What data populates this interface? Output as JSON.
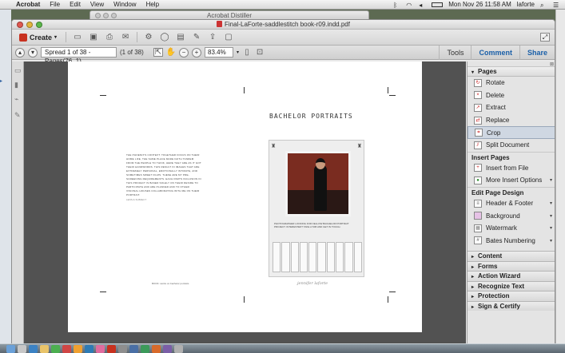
{
  "menubar": {
    "app_name": "Acrobat",
    "menus": [
      "File",
      "Edit",
      "View",
      "Window",
      "Help"
    ],
    "clock": "Mon Nov 26  11:58 AM",
    "user": "laforte"
  },
  "background_window": {
    "title": "Acrobat Distiller"
  },
  "window": {
    "title": "Final-LaForte-saddlestitch book-r09.indd.pdf"
  },
  "toolbar": {
    "create_label": "Create",
    "page_field": "Spread 1 of 38 - Pages(76, 1)",
    "page_count": "(1 of 38)",
    "zoom": "83.4%",
    "tabs": [
      "Tools",
      "Comment",
      "Share"
    ]
  },
  "document": {
    "spread_title": "BACHELOR PORTRAITS",
    "body_text": "THE PHOENIX'S CONTEXT: TOGETHER FOCUS ON THEIR HOME LIFE, THE SAME PLACE MADE FAITH TANDEM FROM THE PEOPLE TO THINK, HERE THEY ARE AS IT GOT THEIR HANDWORDS. THIS RESULT IN IMAGES THAT ARE EXTREMELY PERSONAL, EMOTIONALLY INTIMATE, AND SOMETIMES SWEET FILMS. THESE ARE MY PRE-SCREENING REQUIREMENTS. EACH PARTS INCLUSION IN THIS PROJECT IS BASED SOLELY ON THEIR DESIRE TO PARTICIPATE AND ARE PLANNED AND TO OTHER VISIONAL HOUSES COLLABORATING WITH ME ON THEIR PORTRAIT.",
    "caption": "LENS & SUBJECT",
    "poster_text": "PHOTOGRAPHER LOOKING FOR FELLOW BACHELOR PORTRAIT PROJECT. INTERESTED? TAKE A TAB AND GET IN TOUCH.",
    "signature": "jennifer laforte",
    "footer": "BOOK: works on bachelor portraits"
  },
  "tools_pane": {
    "pages": {
      "header": "Pages",
      "items": [
        {
          "label": "Rotate",
          "icon": "rotate-icon"
        },
        {
          "label": "Delete",
          "icon": "delete-icon"
        },
        {
          "label": "Extract",
          "icon": "extract-icon"
        },
        {
          "label": "Replace",
          "icon": "replace-icon"
        },
        {
          "label": "Crop",
          "icon": "crop-icon"
        },
        {
          "label": "Split Document",
          "icon": "split-icon"
        }
      ]
    },
    "insert_pages": {
      "header": "Insert Pages",
      "items": [
        {
          "label": "Insert from File",
          "icon": "insert-file-icon"
        },
        {
          "label": "More Insert Options",
          "icon": "insert-options-icon"
        }
      ]
    },
    "edit_page_design": {
      "header": "Edit Page Design",
      "items": [
        {
          "label": "Header & Footer",
          "icon": "header-footer-icon"
        },
        {
          "label": "Background",
          "icon": "background-icon"
        },
        {
          "label": "Watermark",
          "icon": "watermark-icon"
        },
        {
          "label": "Bates Numbering",
          "icon": "bates-icon"
        }
      ]
    },
    "collapsed_sections": [
      "Content",
      "Forms",
      "Action Wizard",
      "Recognize Text",
      "Protection",
      "Sign & Certify"
    ]
  },
  "colors": {
    "accent": "#1a5fa8",
    "selected_tool_bg": "#cfd7e2",
    "doc_background": "#525252",
    "desktop": "#5d6a52"
  }
}
